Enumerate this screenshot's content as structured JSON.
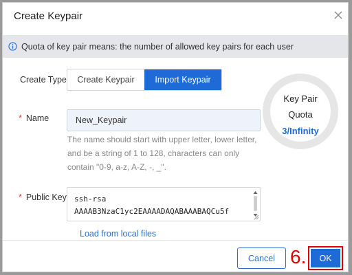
{
  "dialog": {
    "title": "Create Keypair",
    "close_icon": "close-icon"
  },
  "notice": {
    "icon": "info-icon",
    "text": "Quota of key pair means: the number of allowed key pairs for each user"
  },
  "create_type": {
    "label": "Create Type",
    "options": [
      "Create Keypair",
      "Import Keypair"
    ],
    "selected": "Import Keypair"
  },
  "name": {
    "required_mark": "*",
    "label": "Name",
    "value": "New_Keypair",
    "hint": "The name should start with upper letter, lower letter, and be a string of 1 to 128, characters can only contain \"0-9, a-z, A-Z, -, _\"."
  },
  "public_key": {
    "required_mark": "*",
    "label": "Public Key",
    "lines": [
      "ssh-rsa",
      "AAAAB3NzaC1yc2EAAAADAQABAAABAQCu5f"
    ],
    "load_link": "Load from local files"
  },
  "quota": {
    "line1": "Key Pair",
    "line2": "Quota",
    "value": "3/Infinity"
  },
  "footer": {
    "cancel_label": "Cancel",
    "step_marker": "6.",
    "ok_label": "OK"
  },
  "colors": {
    "accent": "#1e6bd8",
    "highlight": "#e00000",
    "required": "#e0443a"
  }
}
